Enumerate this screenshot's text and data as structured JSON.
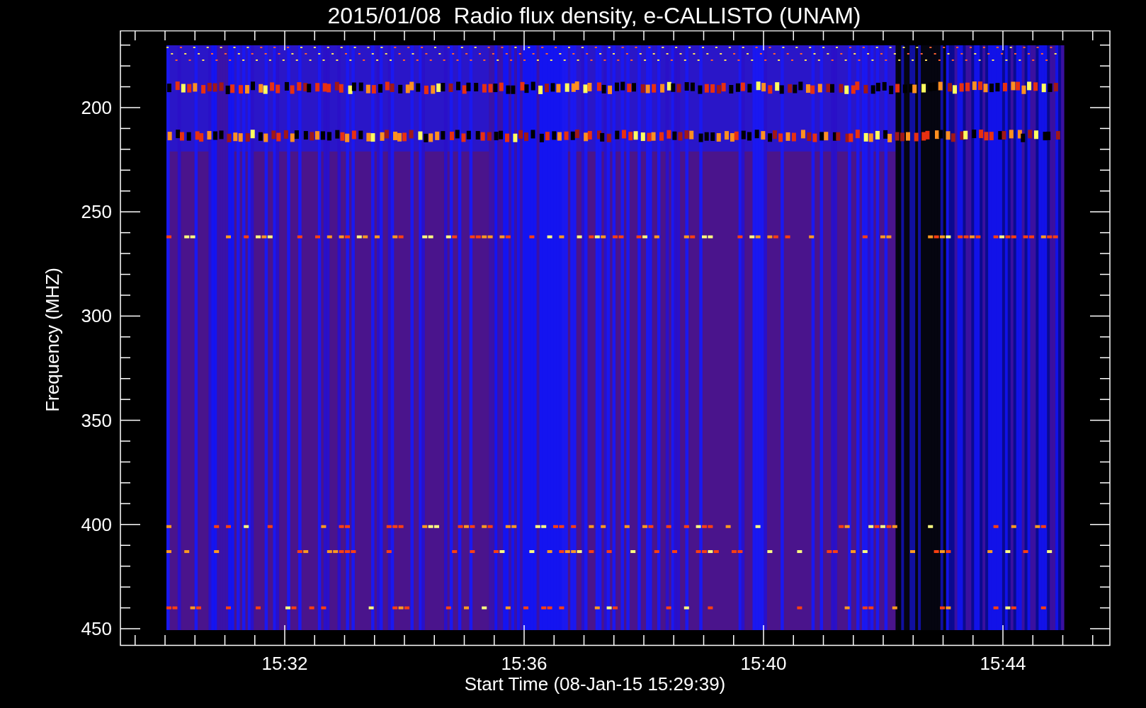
{
  "title": "2015/01/08  Radio flux density, e-CALLISTO (UNAM)",
  "y_axis": {
    "label": "Frequency (MHZ)",
    "ticks": [
      "200",
      "250",
      "300",
      "350",
      "400",
      "450"
    ]
  },
  "x_axis": {
    "label": "Start Time (08-Jan-15 15:29:39)",
    "ticks": [
      "15:32",
      "15:36",
      "15:40",
      "15:44"
    ]
  }
}
